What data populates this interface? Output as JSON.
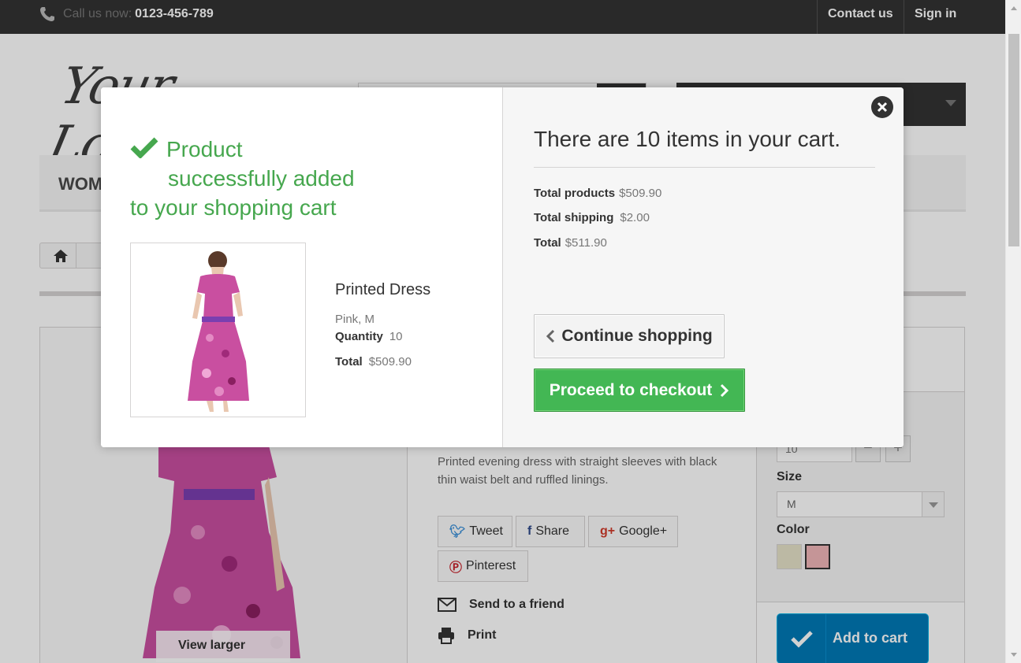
{
  "topbar": {
    "phone_label": "Call us now:",
    "phone_number": "0123-456-789",
    "contact": "Contact us",
    "signin": "Sign in"
  },
  "header": {
    "logo_text": "Your Logo",
    "menu_item": "WOMEN"
  },
  "product_page": {
    "view_larger": "View larger",
    "description": "Printed evening dress with straight sleeves with black thin waist belt and ruffled linings.",
    "share": {
      "tweet": "Tweet",
      "share": "Share",
      "google": "Google+",
      "pinterest": "Pinterest"
    },
    "send_to_friend": "Send to a friend",
    "print": "Print",
    "quantity_value": "10",
    "size_label": "Size",
    "size_value": "M",
    "color_label": "Color",
    "colors": [
      "#e6e2c9",
      "#f1b6b9"
    ],
    "add_to_cart": "Add to cart"
  },
  "modal": {
    "success_line1": "Product",
    "success_line2": "successfully added",
    "success_line3": "to your shopping cart",
    "product_name": "Printed Dress",
    "product_attributes": "Pink, M",
    "quantity_label": "Quantity",
    "quantity": "10",
    "total_label": "Total",
    "total": "$509.90",
    "cart_count_text": "There are 10 items in your cart.",
    "total_products_label": "Total products",
    "total_products": "$509.90",
    "total_shipping_label": "Total shipping",
    "total_shipping": "$2.00",
    "grand_total_label": "Total",
    "grand_total": "$511.90",
    "continue_shopping": "Continue shopping",
    "proceed_to_checkout": "Proceed to checkout"
  },
  "colors": {
    "success_green": "#46a74e",
    "checkout_green": "#43b754",
    "add_to_cart_blue": "#0079b6",
    "topbar_dark": "#333333"
  }
}
